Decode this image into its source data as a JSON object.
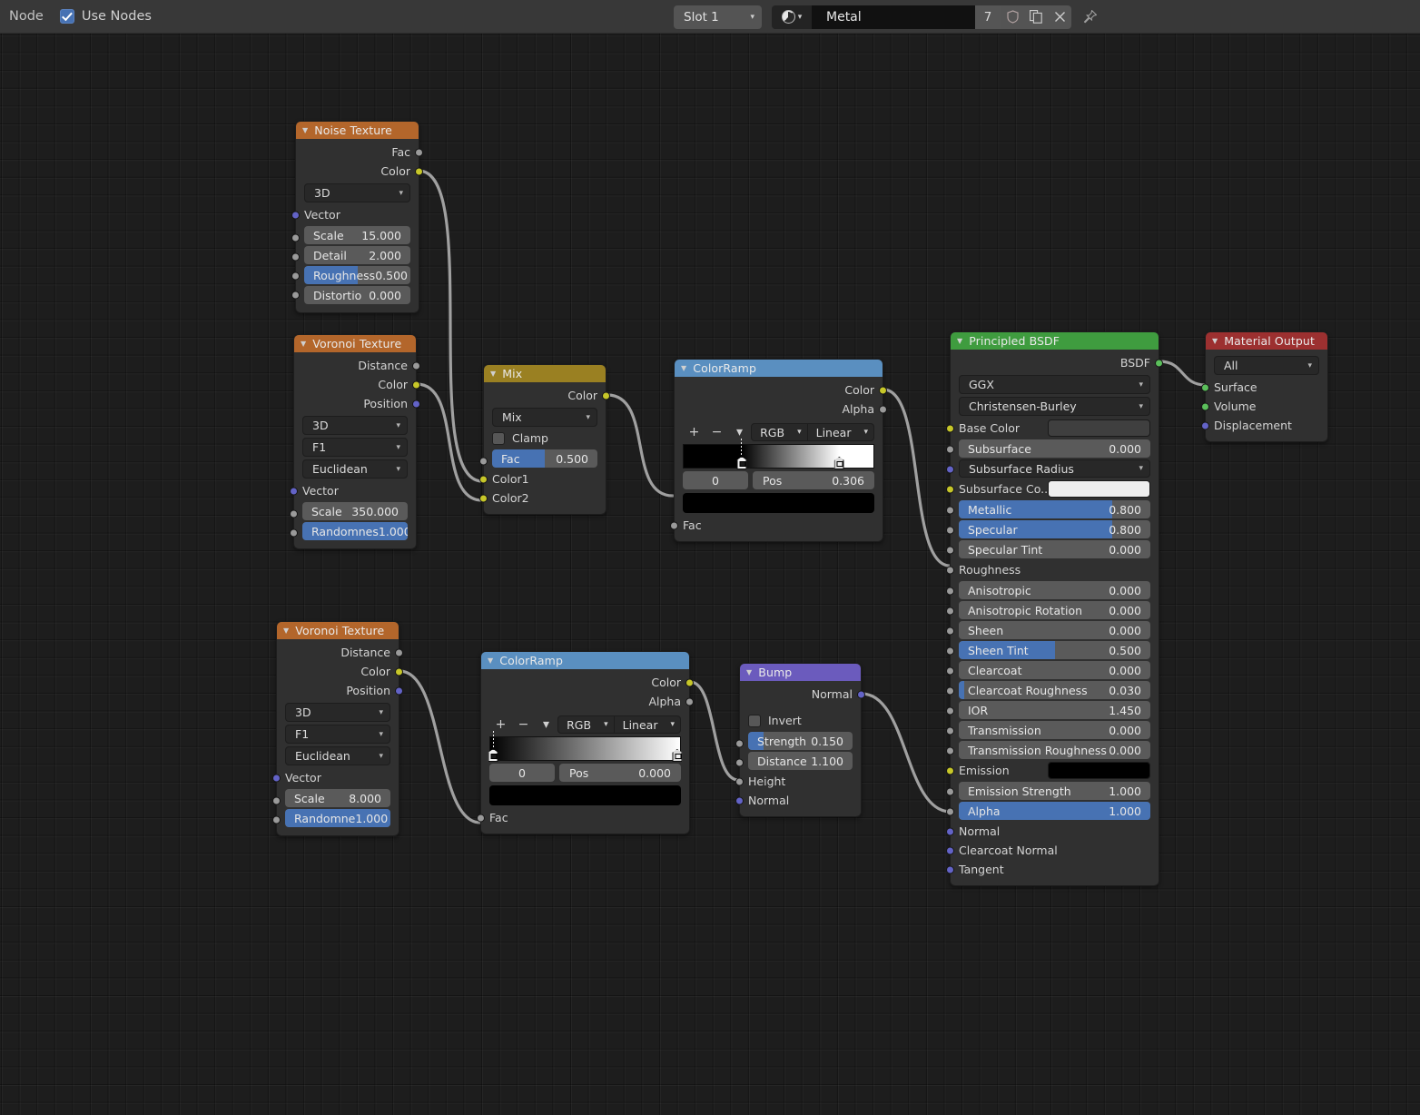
{
  "header": {
    "menu_label": "Node",
    "use_nodes_label": "Use Nodes",
    "use_nodes_checked": true,
    "slot_value": "Slot 1",
    "material_name": "Metal",
    "material_users": "7",
    "icons": {
      "material_sphere": "material-sphere-icon",
      "shield": "fake-user-shield-icon",
      "copy": "new-material-copy-icon",
      "close": "unlink-x-icon",
      "pin": "pin-icon"
    }
  },
  "colors": {
    "header_texture": "#b3662b",
    "header_color": "#5a8fc0",
    "header_converter": "#9a8022",
    "header_vector": "#6b5bbd",
    "header_shader": "#3f9c3f",
    "header_output": "#9c3030",
    "accent_blue": "#4772b3",
    "socket_yellow": "#c7c729",
    "socket_grey": "#9a9a9a",
    "socket_purple": "#6363c7",
    "socket_green": "#5bbf5b",
    "wire": "#9e9e9e",
    "canvas_bg": "#1d1d1d"
  },
  "nodes": {
    "noise_texture": {
      "title": "Noise Texture",
      "outputs": [
        "Fac",
        "Color"
      ],
      "dimension": "3D",
      "vector_label": "Vector",
      "fields": [
        {
          "name": "Scale",
          "value": "15.000",
          "fill": 0
        },
        {
          "name": "Detail",
          "value": "2.000",
          "fill": 0
        },
        {
          "name": "Roughness",
          "value": "0.500",
          "fill": 0.5
        },
        {
          "name": "Distortio",
          "value": "0.000",
          "fill": 0
        }
      ]
    },
    "voronoi_top": {
      "title": "Voronoi Texture",
      "outputs": [
        "Distance",
        "Color",
        "Position"
      ],
      "dimension": "3D",
      "feature": "F1",
      "metric": "Euclidean",
      "vector_label": "Vector",
      "fields": [
        {
          "name": "Scale",
          "value": "350.000",
          "fill": 0
        },
        {
          "name": "Randomnes",
          "value": "1.000",
          "fill": 1
        }
      ]
    },
    "mix": {
      "title": "Mix",
      "outputs": [
        "Color"
      ],
      "blend_mode": "Mix",
      "clamp_label": "Clamp",
      "clamp_checked": false,
      "fac": {
        "name": "Fac",
        "value": "0.500",
        "fill": 0.5
      },
      "inputs": [
        "Color1",
        "Color2"
      ]
    },
    "colorramp_top": {
      "title": "ColorRamp",
      "outputs": [
        "Color",
        "Alpha"
      ],
      "interpolation_color_mode": "RGB",
      "interpolation": "Linear",
      "index": "0",
      "pos_label": "Pos",
      "pos_value": "0.306",
      "swatch": "#000000",
      "stops": [
        {
          "pos": 0.306,
          "color": "#000000",
          "active": true
        },
        {
          "pos": 0.82,
          "color": "#ffffff",
          "active": false
        }
      ],
      "input_label": "Fac",
      "add_label": "+",
      "remove_label": "−"
    },
    "voronoi_bottom": {
      "title": "Voronoi Texture",
      "outputs": [
        "Distance",
        "Color",
        "Position"
      ],
      "dimension": "3D",
      "feature": "F1",
      "metric": "Euclidean",
      "vector_label": "Vector",
      "fields": [
        {
          "name": "Scale",
          "value": "8.000",
          "fill": 0
        },
        {
          "name": "Randomne",
          "value": "1.000",
          "fill": 1
        }
      ]
    },
    "colorramp_bottom": {
      "title": "ColorRamp",
      "outputs": [
        "Color",
        "Alpha"
      ],
      "interpolation_color_mode": "RGB",
      "interpolation": "Linear",
      "index": "0",
      "pos_label": "Pos",
      "pos_value": "0.000",
      "swatch": "#000000",
      "stops": [
        {
          "pos": 0.0,
          "color": "#000000",
          "active": true
        },
        {
          "pos": 1.0,
          "color": "#ffffff",
          "active": false
        }
      ],
      "input_label": "Fac",
      "add_label": "+",
      "remove_label": "−"
    },
    "bump": {
      "title": "Bump",
      "outputs": [
        "Normal"
      ],
      "invert_label": "Invert",
      "invert_checked": false,
      "fields": [
        {
          "name": "Strength",
          "value": "0.150",
          "fill": 0.15
        },
        {
          "name": "Distance",
          "value": "1.100",
          "fill": 0
        }
      ],
      "inputs": [
        "Height",
        "Normal"
      ]
    },
    "principled_bsdf": {
      "title": "Principled BSDF",
      "outputs": [
        "BSDF"
      ],
      "distribution": "GGX",
      "subsurface_method": "Christensen-Burley",
      "rows": [
        {
          "kind": "swatch",
          "name": "Base Color",
          "socket": "yellow",
          "color": "#3f3f3f"
        },
        {
          "kind": "field",
          "name": "Subsurface",
          "value": "0.000",
          "fill": 0,
          "socket": "grey"
        },
        {
          "kind": "dropdown",
          "name": "Subsurface Radius",
          "socket": "purple"
        },
        {
          "kind": "swatch",
          "name": "Subsurface Co...",
          "socket": "yellow",
          "color": "#eeeeee"
        },
        {
          "kind": "field",
          "name": "Metallic",
          "value": "0.800",
          "fill": 0.8,
          "socket": "grey"
        },
        {
          "kind": "field",
          "name": "Specular",
          "value": "0.800",
          "fill": 0.8,
          "socket": "grey"
        },
        {
          "kind": "field",
          "name": "Specular Tint",
          "value": "0.000",
          "fill": 0,
          "socket": "grey"
        },
        {
          "kind": "label",
          "name": "Roughness",
          "socket": "grey"
        },
        {
          "kind": "field",
          "name": "Anisotropic",
          "value": "0.000",
          "fill": 0,
          "socket": "grey"
        },
        {
          "kind": "field",
          "name": "Anisotropic Rotation",
          "value": "0.000",
          "fill": 0,
          "socket": "grey"
        },
        {
          "kind": "field",
          "name": "Sheen",
          "value": "0.000",
          "fill": 0,
          "socket": "grey"
        },
        {
          "kind": "field",
          "name": "Sheen Tint",
          "value": "0.500",
          "fill": 0.5,
          "socket": "grey"
        },
        {
          "kind": "field",
          "name": "Clearcoat",
          "value": "0.000",
          "fill": 0,
          "socket": "grey"
        },
        {
          "kind": "field",
          "name": "Clearcoat Roughness",
          "value": "0.030",
          "fill": 0.03,
          "socket": "grey"
        },
        {
          "kind": "field",
          "name": "IOR",
          "value": "1.450",
          "fill": 0,
          "socket": "grey"
        },
        {
          "kind": "field",
          "name": "Transmission",
          "value": "0.000",
          "fill": 0,
          "socket": "grey"
        },
        {
          "kind": "field",
          "name": "Transmission Roughness",
          "value": "0.000",
          "fill": 0,
          "socket": "grey"
        },
        {
          "kind": "swatch",
          "name": "Emission",
          "socket": "yellow",
          "color": "#000000"
        },
        {
          "kind": "field",
          "name": "Emission Strength",
          "value": "1.000",
          "fill": 0,
          "socket": "grey"
        },
        {
          "kind": "field",
          "name": "Alpha",
          "value": "1.000",
          "fill": 1,
          "socket": "grey"
        },
        {
          "kind": "label",
          "name": "Normal",
          "socket": "purple"
        },
        {
          "kind": "label",
          "name": "Clearcoat Normal",
          "socket": "purple"
        },
        {
          "kind": "label",
          "name": "Tangent",
          "socket": "purple"
        }
      ]
    },
    "material_output": {
      "title": "Material Output",
      "target": "All",
      "inputs": [
        "Surface",
        "Volume",
        "Displacement"
      ]
    }
  },
  "links": [
    {
      "from": "Noise Texture.Color",
      "to": "Mix.Color1"
    },
    {
      "from": "Voronoi Texture (top).Color",
      "to": "Mix.Color2"
    },
    {
      "from": "Mix.Color",
      "to": "ColorRamp (top).Fac"
    },
    {
      "from": "ColorRamp (top).Color",
      "to": "Principled BSDF.Roughness"
    },
    {
      "from": "Voronoi Texture (bottom).Color",
      "to": "ColorRamp (bottom).Fac"
    },
    {
      "from": "ColorRamp (bottom).Color",
      "to": "Bump.Height"
    },
    {
      "from": "Bump.Normal",
      "to": "Principled BSDF.Normal"
    },
    {
      "from": "Principled BSDF.BSDF",
      "to": "Material Output.Surface"
    }
  ]
}
